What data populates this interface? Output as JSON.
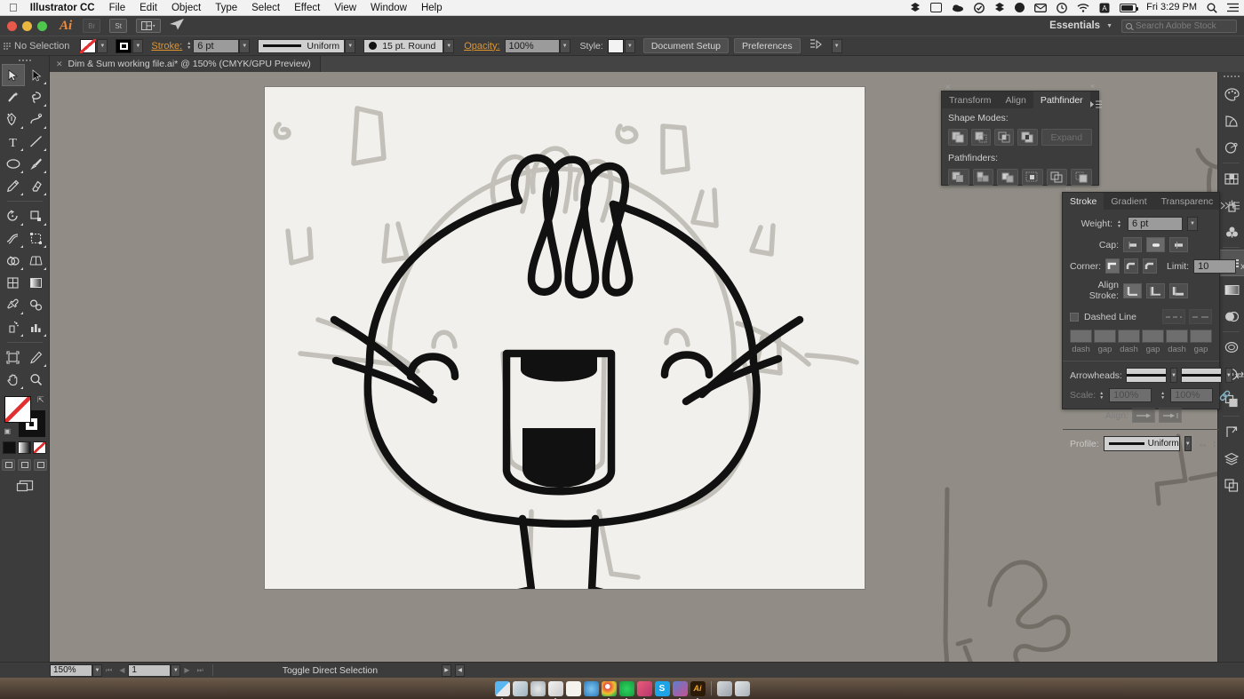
{
  "macbar": {
    "apple": "apple-logo",
    "app_name": "Illustrator CC",
    "menus": [
      "File",
      "Edit",
      "Object",
      "Type",
      "Select",
      "Effect",
      "View",
      "Window",
      "Help"
    ],
    "time": "Fri 3:29 PM",
    "status_icons": [
      "dropbox-icon",
      "display-icon",
      "cloud-icon",
      "checkmark-icon",
      "dropbox-blue-icon",
      "droplet-icon",
      "mail-icon",
      "clock-icon",
      "wifi-icon",
      "keyboard-input-icon",
      "battery-icon"
    ],
    "spotlight": "search-icon",
    "notification_center": "list-icon"
  },
  "titlebar": {
    "app_badge": "Ai",
    "bridge_button": "Br",
    "stock_button": "St",
    "arrange_button": "arrange-documents",
    "share_button": "share-icon",
    "workspace": "Essentials",
    "search_placeholder": "Search Adobe Stock"
  },
  "controlbar": {
    "selection_status": "No Selection",
    "fill_swatch": "None",
    "stroke_swatch": "Black",
    "stroke_label": "Stroke:",
    "stroke_weight": "6 pt",
    "variable_width_profile": "Uniform",
    "brush_definition": "15 pt. Round",
    "opacity_label": "Opacity:",
    "opacity_value": "100%",
    "style_label": "Style:",
    "document_setup": "Document Setup",
    "preferences": "Preferences"
  },
  "document": {
    "tab_title": "Dim & Sum working file.ai* @ 150% (CMYK/GPU Preview)"
  },
  "tools": [
    {
      "name": "selection-tool",
      "selected": true
    },
    {
      "name": "direct-selection-tool",
      "selected": false
    },
    {
      "name": "magic-wand-tool",
      "selected": false
    },
    {
      "name": "lasso-tool",
      "selected": false
    },
    {
      "name": "pen-tool",
      "selected": false
    },
    {
      "name": "curvature-tool",
      "selected": false
    },
    {
      "name": "type-tool",
      "selected": false
    },
    {
      "name": "line-segment-tool",
      "selected": false
    },
    {
      "name": "ellipse-tool",
      "selected": false
    },
    {
      "name": "paintbrush-tool",
      "selected": false
    },
    {
      "name": "pencil-tool",
      "selected": false
    },
    {
      "name": "eraser-tool",
      "selected": false
    },
    {
      "name": "rotate-tool",
      "selected": false
    },
    {
      "name": "scale-tool",
      "selected": false
    },
    {
      "name": "width-tool",
      "selected": false
    },
    {
      "name": "free-transform-tool",
      "selected": false
    },
    {
      "name": "shape-builder-tool",
      "selected": false
    },
    {
      "name": "perspective-grid-tool",
      "selected": false
    },
    {
      "name": "mesh-tool",
      "selected": false
    },
    {
      "name": "gradient-tool",
      "selected": false
    },
    {
      "name": "eyedropper-tool",
      "selected": false
    },
    {
      "name": "blend-tool",
      "selected": false
    },
    {
      "name": "symbol-sprayer-tool",
      "selected": false
    },
    {
      "name": "column-graph-tool",
      "selected": false
    },
    {
      "name": "artboard-tool",
      "selected": false
    },
    {
      "name": "slice-tool",
      "selected": false
    },
    {
      "name": "hand-tool",
      "selected": false
    },
    {
      "name": "zoom-tool",
      "selected": false
    }
  ],
  "pathfinder_panel": {
    "tabs": [
      {
        "label": "Transform",
        "active": false
      },
      {
        "label": "Align",
        "active": false
      },
      {
        "label": "Pathfinder",
        "active": true
      }
    ],
    "shape_modes_label": "Shape Modes:",
    "shape_modes": [
      "unite",
      "minus-front",
      "intersect",
      "exclude"
    ],
    "expand_label": "Expand",
    "pathfinders_label": "Pathfinders:",
    "pathfinders": [
      "divide",
      "trim",
      "merge",
      "crop",
      "outline",
      "minus-back"
    ]
  },
  "stroke_panel": {
    "tabs": [
      {
        "label": "Stroke",
        "active": true
      },
      {
        "label": "Gradient",
        "active": false
      },
      {
        "label": "Transparenc",
        "active": false
      }
    ],
    "weight_label": "Weight:",
    "weight_value": "6 pt",
    "cap_label": "Cap:",
    "cap_options": [
      "butt-cap",
      "round-cap",
      "projecting-cap"
    ],
    "corner_label": "Corner:",
    "corner_options": [
      "miter-join",
      "round-join",
      "bevel-join"
    ],
    "limit_label": "Limit:",
    "limit_value": "10",
    "limit_unit": "x",
    "align_stroke_label": "Align Stroke:",
    "align_options": [
      "align-center",
      "align-inside",
      "align-outside"
    ],
    "dashed_line_label": "Dashed Line",
    "dash_labels": [
      "dash",
      "gap",
      "dash",
      "gap",
      "dash",
      "gap"
    ],
    "arrowheads_label": "Arrowheads:",
    "scale_label": "Scale:",
    "scale_start": "100%",
    "scale_end": "100%",
    "align_label": "Align:",
    "profile_label": "Profile:",
    "profile_value": "Uniform"
  },
  "icon_dock": [
    {
      "name": "color-panel-icon",
      "selected": false
    },
    {
      "name": "color-guide-panel-icon",
      "selected": false
    },
    {
      "name": "edit-colors-panel-icon",
      "selected": false
    },
    {
      "name": "swatches-panel-icon",
      "selected": false
    },
    {
      "name": "brushes-panel-icon",
      "selected": false
    },
    {
      "name": "symbols-panel-icon",
      "selected": false
    },
    {
      "name": "stroke-panel-icon",
      "selected": true
    },
    {
      "name": "gradient-panel-icon",
      "selected": false
    },
    {
      "name": "transparency-panel-icon",
      "selected": false
    },
    {
      "name": "graphic-styles-panel-icon",
      "selected": false
    },
    {
      "name": "appearance-panel-icon",
      "selected": false
    },
    {
      "name": "pathfinder-panel-icon",
      "selected": false
    },
    {
      "name": "align-panel-icon",
      "selected": false
    },
    {
      "name": "layers-panel-icon",
      "selected": false
    },
    {
      "name": "artboards-panel-icon",
      "selected": false
    }
  ],
  "statusbar": {
    "zoom_level": "150%",
    "page_number": "1",
    "status_text": "Toggle Direct Selection"
  },
  "macdock": {
    "apps": [
      "finder",
      "mail",
      "safari",
      "numbers",
      "pages",
      "preview",
      "chrome",
      "spotify",
      "photoshop",
      "skype",
      "illustrator-doc",
      "illustrator",
      "folder",
      "trash"
    ]
  },
  "artwork": {
    "description": "Hand-drawn dumpling character with pleated top, arc eyes, open smiling mouth, stick arms and legs, vectorized in black over grey pencil sketch",
    "ink_color": "#111111",
    "sketch_color": "#b9b6b0",
    "paper_color": "#f2f0ec"
  },
  "colors": {
    "panel_bg": "#3c3c3c",
    "app_bg": "#535353",
    "accent_orange": "#e0952f",
    "pasteboard": "#918d86"
  }
}
